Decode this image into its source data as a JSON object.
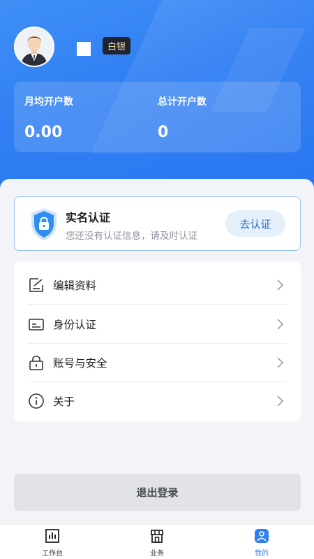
{
  "profile": {
    "level_badge": "白银"
  },
  "stats": {
    "monthly_label": "月均开户数",
    "monthly_value": "0.00",
    "total_label": "总计开户数",
    "total_value": "0"
  },
  "verify": {
    "title": "实名认证",
    "subtitle": "您还没有认证信息，请及时认证",
    "button": "去认证"
  },
  "menu": {
    "items": [
      {
        "label": "编辑资料",
        "icon": "edit-icon"
      },
      {
        "label": "身份认证",
        "icon": "id-card-icon"
      },
      {
        "label": "账号与安全",
        "icon": "lock-icon"
      },
      {
        "label": "关于",
        "icon": "info-icon"
      }
    ]
  },
  "logout": {
    "label": "退出登录"
  },
  "tabbar": {
    "items": [
      {
        "label": "工作台",
        "icon": "chart-icon"
      },
      {
        "label": "业务",
        "icon": "store-icon"
      },
      {
        "label": "我的",
        "icon": "user-icon"
      }
    ],
    "active_color": "#2f7ef3"
  },
  "colors": {
    "header_blue": "#2f7ef3",
    "badge_bg": "#1e2430",
    "badge_text": "#f3d9a2"
  }
}
